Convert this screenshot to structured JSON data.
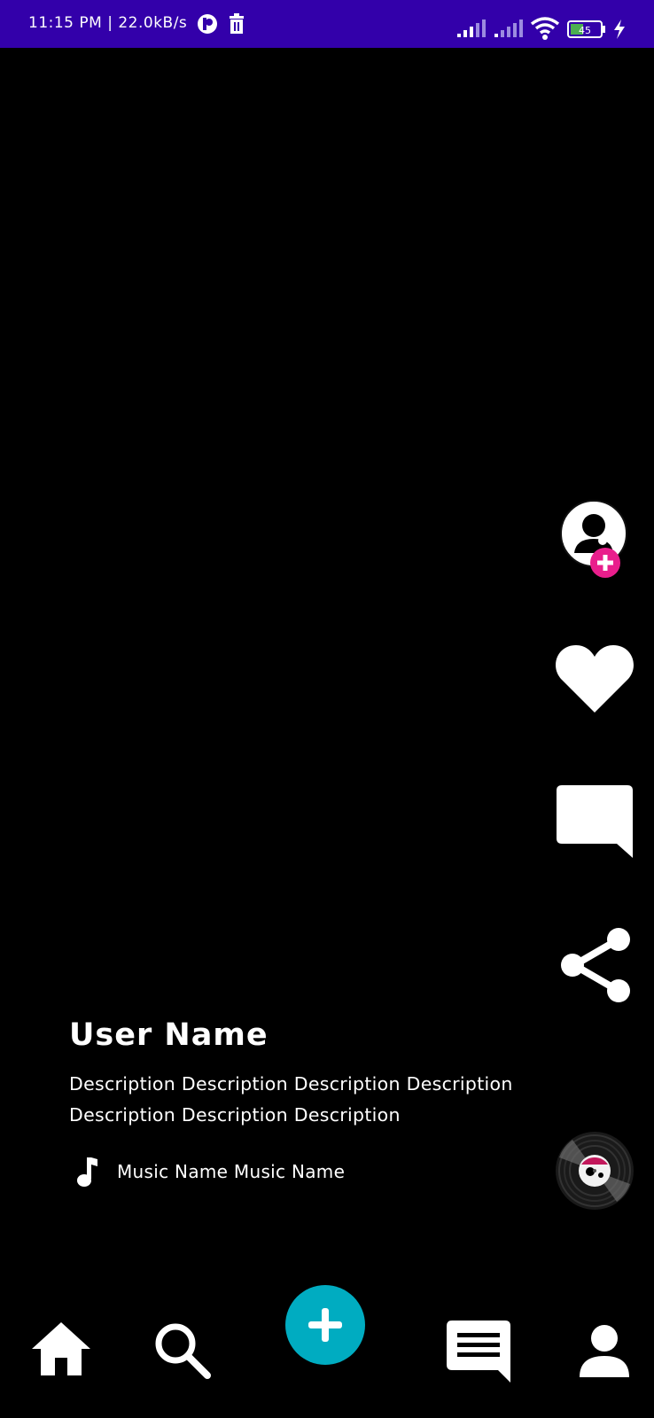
{
  "status_bar": {
    "time_speed": "11:15 PM | 22.0kB/s",
    "battery_level": "45",
    "icons": [
      "app-notification-icon",
      "trash-icon",
      "signal-icon",
      "signal-icon",
      "wifi-icon",
      "battery-icon",
      "charging-icon"
    ]
  },
  "video": {
    "user_name": "User Name",
    "description": "Description Description Description Description Description Description Description",
    "music_name": "Music Name Music Name"
  },
  "right_rail": {
    "icons": [
      "profile-follow-icon",
      "heart-icon",
      "comment-icon",
      "share-icon",
      "music-disc-icon"
    ]
  },
  "bottom_nav": {
    "icons": [
      "home-icon",
      "search-icon",
      "add-icon",
      "inbox-icon",
      "profile-icon"
    ]
  },
  "colors": {
    "status_bar": "#3300aa",
    "background": "#000000",
    "fab": "#00acc1",
    "follow_badge": "#e91e8c"
  }
}
